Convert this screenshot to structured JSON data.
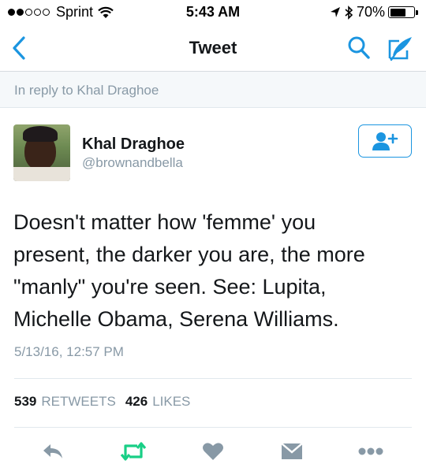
{
  "status_bar": {
    "carrier": "Sprint",
    "time": "5:43 AM",
    "battery": "70%",
    "battery_level": 0.7,
    "signal_bars_filled": 2,
    "signal_bars_total": 5,
    "icons": [
      "wifi-icon",
      "location-arrow-icon",
      "bluetooth-icon",
      "battery-icon"
    ]
  },
  "nav": {
    "title": "Tweet",
    "icons": [
      "back-chevron-icon",
      "search-icon",
      "compose-icon"
    ],
    "accent_color": "#1b95e0"
  },
  "reply_banner": {
    "text": "In reply to Khal Draghoe"
  },
  "tweet": {
    "author_name": "Khal Draghoe",
    "author_handle": "@brownandbella",
    "text": "Doesn't matter how 'femme' you\npresent, the darker you are, the more\n\"manly\" you're seen. See: Lupita,\nMichelle Obama, Serena Williams.",
    "timestamp": "5/13/16, 12:57 PM",
    "follow_icon": "add-user-icon"
  },
  "stats": {
    "retweets_count": "539",
    "retweets_label": "RETWEETS",
    "likes_count": "426",
    "likes_label": "LIKES"
  },
  "actions": {
    "icons": [
      "reply-icon",
      "retweet-icon",
      "like-heart-icon",
      "direct-message-icon",
      "more-icon"
    ],
    "retweet_color": "#19cf86",
    "icon_color": "#8899a6"
  }
}
